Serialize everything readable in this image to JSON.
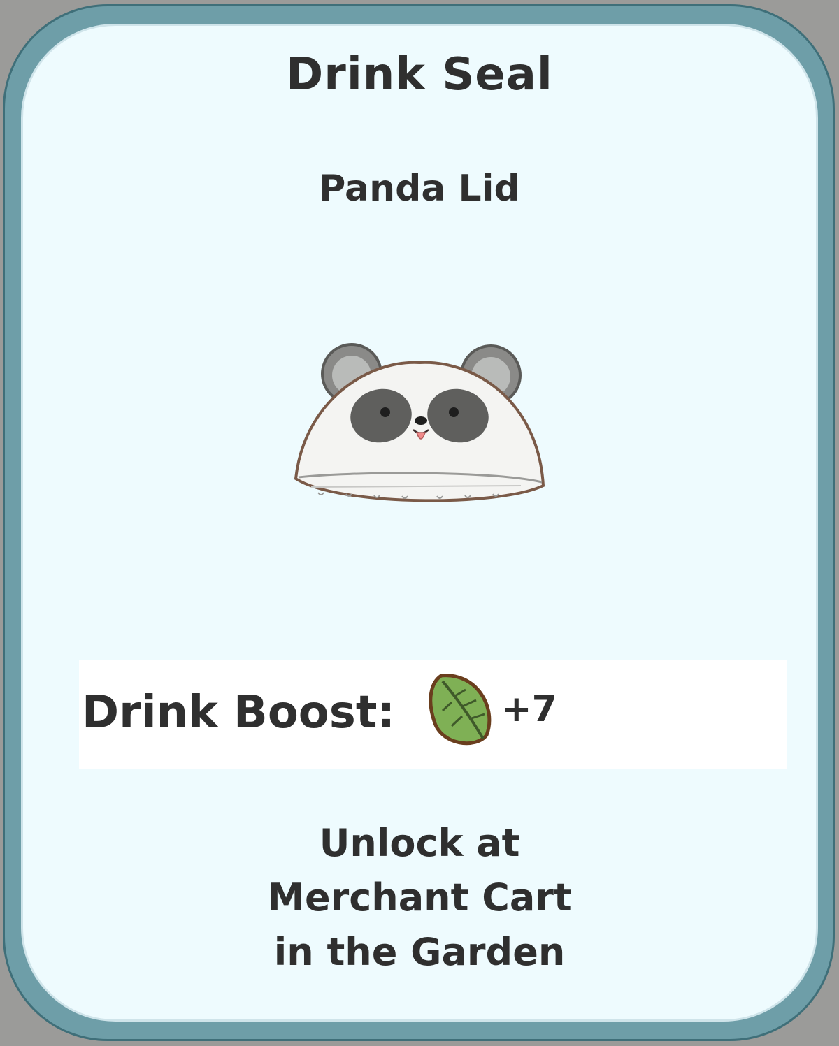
{
  "card": {
    "title": "Drink Seal",
    "item_name": "Panda Lid",
    "item_icon": "panda-lid-icon",
    "boost": {
      "label": "Drink Boost:",
      "icon": "leaf-icon",
      "value": "+7"
    },
    "unlock_lines": [
      "Unlock at",
      "Merchant Cart",
      "in the Garden"
    ]
  },
  "colors": {
    "frame": "#6e9ea8",
    "panel": "#eefbfe",
    "text": "#2f2f2f",
    "leaf": "#7fb055"
  }
}
